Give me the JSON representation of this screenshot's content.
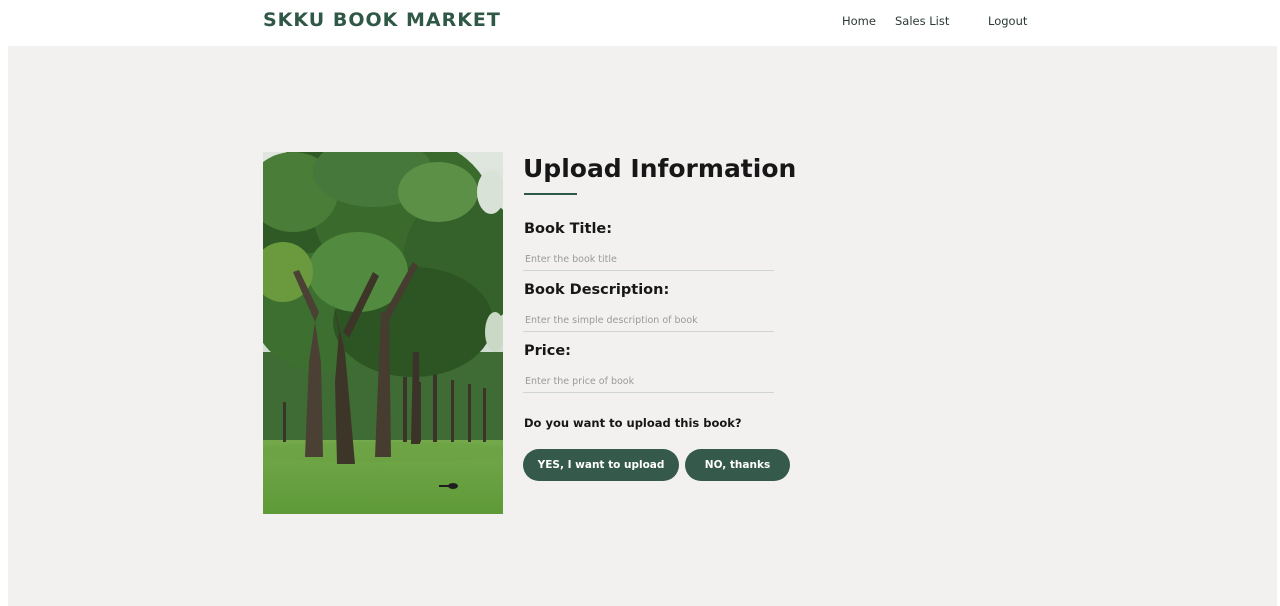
{
  "header": {
    "brand": "SKKU BOOK MARKET",
    "nav": {
      "home": "Home",
      "sales_list": "Sales List",
      "logout": "Logout"
    }
  },
  "form": {
    "title": "Upload Information",
    "book_title": {
      "label": "Book Title:",
      "placeholder": "Enter the book title",
      "value": ""
    },
    "book_description": {
      "label": "Book Description:",
      "placeholder": "Enter the simple description of book",
      "value": ""
    },
    "price": {
      "label": "Price:",
      "placeholder": "Enter the price of book",
      "value": ""
    },
    "question": "Do you want to upload this book?",
    "yes_button": "YES, I want to upload",
    "no_button": "NO, thanks"
  },
  "image": {
    "subject": "trees-in-park-photo"
  },
  "colors": {
    "accent": "#2f5846",
    "button": "#355a4b",
    "panel_bg": "#f2f1ef"
  }
}
